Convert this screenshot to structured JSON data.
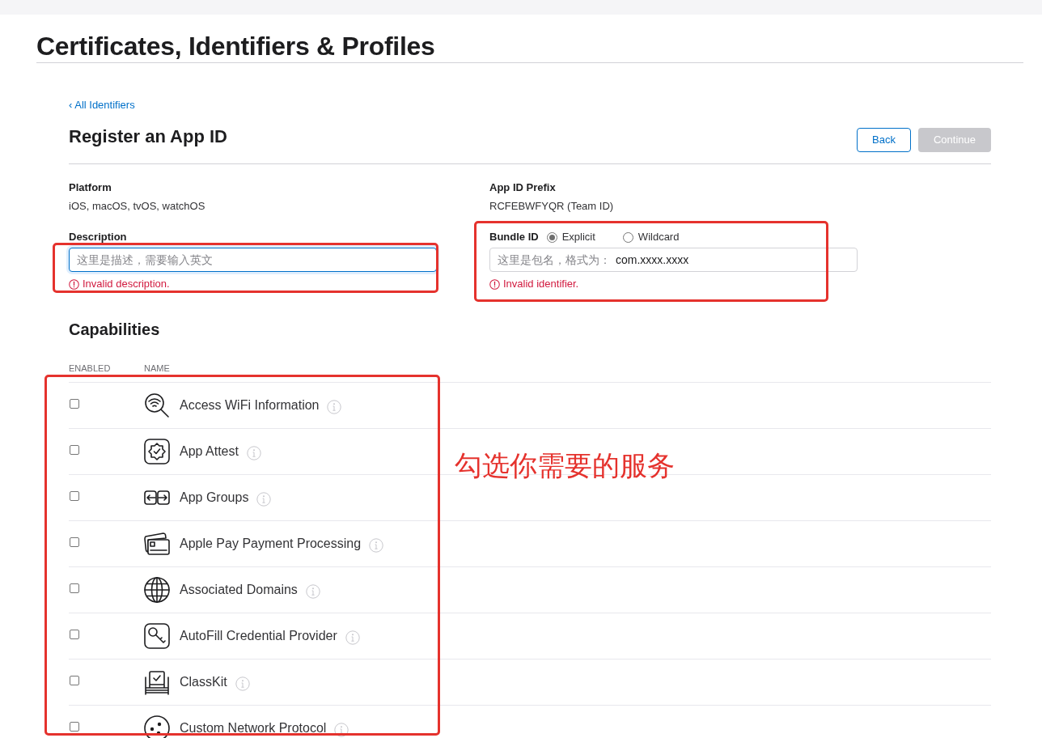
{
  "header": {
    "title": "Certificates, Identifiers & Profiles"
  },
  "back_link": {
    "label": "‹ All Identifiers"
  },
  "page_title": "Register an App ID",
  "buttons": [
    {
      "label": "Back",
      "kind": "secondary",
      "disabled": false
    },
    {
      "label": "Continue",
      "kind": "primary",
      "disabled": true
    }
  ],
  "platform": {
    "label": "Platform",
    "value": "iOS, macOS, tvOS, watchOS"
  },
  "app_id_prefix": {
    "label": "App ID Prefix",
    "value": "RCFEBWFYQR (Team ID)"
  },
  "description": {
    "label": "Description",
    "placeholder": "这里是描述，需要输入英文",
    "focused": true,
    "error": "Invalid description."
  },
  "bundle_id": {
    "label": "Bundle ID",
    "options": [
      {
        "label": "Explicit",
        "selected": true
      },
      {
        "label": "Wildcard",
        "selected": false
      }
    ],
    "placeholder": "这里是包名，格式为：",
    "value": "com.xxxx.xxxx",
    "focused": false,
    "error": "Invalid identifier."
  },
  "capabilities": {
    "title": "Capabilities",
    "columns": [
      "ENABLED",
      "NAME"
    ],
    "rows": [
      {
        "name": "Access WiFi Information",
        "checked": false
      },
      {
        "name": "App Attest",
        "checked": false
      },
      {
        "name": "App Groups",
        "checked": false
      },
      {
        "name": "Apple Pay Payment Processing",
        "checked": false
      },
      {
        "name": "Associated Domains",
        "checked": false
      },
      {
        "name": "AutoFill Credential Provider",
        "checked": false
      },
      {
        "name": "ClassKit",
        "checked": false
      },
      {
        "name": "Custom Network Protocol",
        "checked": false
      }
    ]
  },
  "annotation": {
    "note": "勾选你需要的服务"
  }
}
